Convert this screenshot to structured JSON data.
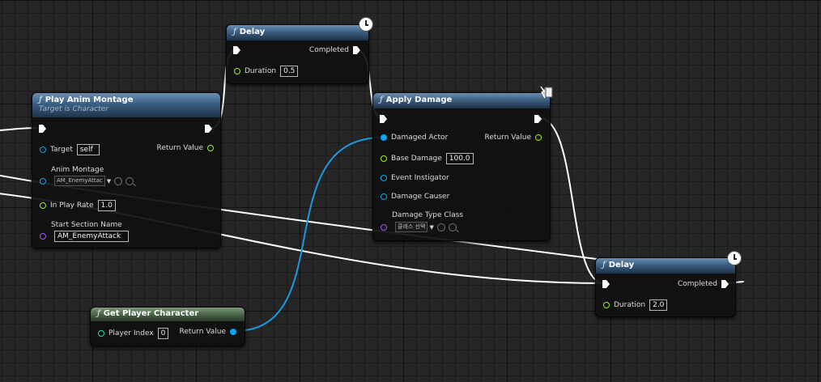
{
  "nodes": {
    "delay_top": {
      "title": "Delay",
      "pins": {
        "completed": "Completed",
        "duration": "Duration"
      },
      "values": {
        "duration": "0.5"
      }
    },
    "play_anim_montage": {
      "title": "Play Anim Montage",
      "subtitle": "Target is Character",
      "pins": {
        "target": "Target",
        "return_value": "Return Value",
        "anim_montage": "Anim Montage",
        "in_play_rate": "In Play Rate",
        "start_section_name": "Start Section Name"
      },
      "values": {
        "target": "self",
        "anim_montage": "AM_EnemyAttac",
        "in_play_rate": "1.0",
        "start_section_name": "AM_EnemyAttack"
      }
    },
    "apply_damage": {
      "title": "Apply Damage",
      "pins": {
        "damaged_actor": "Damaged Actor",
        "return_value": "Return Value",
        "base_damage": "Base Damage",
        "event_instigator": "Event Instigator",
        "damage_causer": "Damage Causer",
        "damage_type_class": "Damage Type Class"
      },
      "values": {
        "base_damage": "100.0",
        "damage_type_class": "클래스 선택"
      }
    },
    "get_player_character": {
      "title": "Get Player Character",
      "pins": {
        "player_index": "Player Index",
        "return_value": "Return Value"
      },
      "values": {
        "player_index": "0"
      }
    },
    "delay_bottom": {
      "title": "Delay",
      "pins": {
        "completed": "Completed",
        "duration": "Duration"
      },
      "values": {
        "duration": "2.0"
      }
    }
  },
  "colors": {
    "exec": "#ffffff",
    "object_pin": "#00a8f3",
    "float_pin": "#9af01e",
    "name_pin": "#a052ff",
    "int_pin": "#1fe0a8",
    "function_header": "#3b5f82",
    "pure_header": "#4d6a4a"
  }
}
